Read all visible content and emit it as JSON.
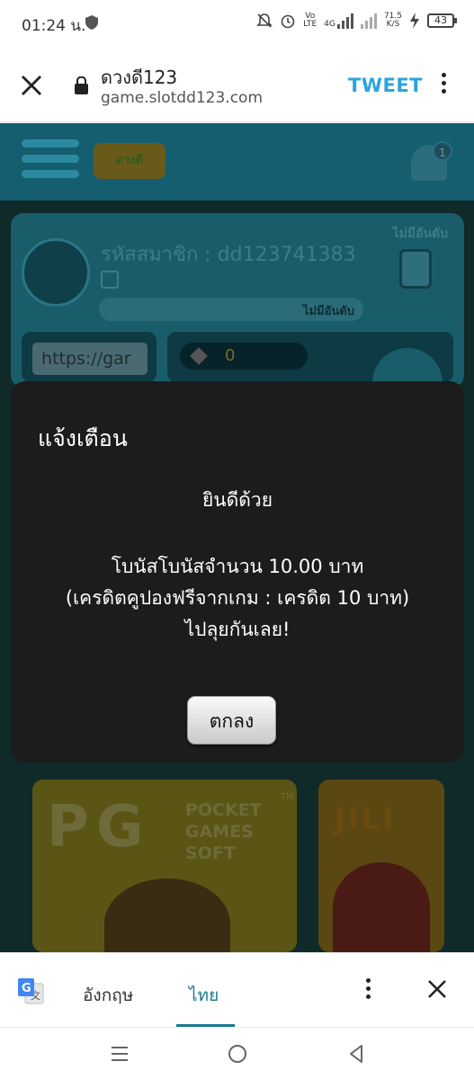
{
  "status_bar": {
    "time": "01:24 น.",
    "network_label_top": "Vo",
    "network_label_bottom": "LTE",
    "net_gen": "4G",
    "speed_value": "71.5",
    "speed_unit": "K/S",
    "battery": "43"
  },
  "browser": {
    "page_title": "ดวงดี123",
    "url": "game.slotdd123.com",
    "tweet_label": "TWEET"
  },
  "game": {
    "logo_text": "ดวงดี",
    "notification_count": "1",
    "member_code": "รหัสสมาชิก : dd123741383",
    "rank_label_top": "ไม่มีอันดับ",
    "rank_label_bar": "ไม่มีอันดับ",
    "referral_url": "https://gar",
    "credit": "0",
    "pg_big": "PG",
    "pg_words": [
      "POCKET",
      "GAMES",
      "SOFT"
    ],
    "pg_tm": "TM",
    "jili_text": "JILI"
  },
  "dialog": {
    "title": "แจ้งเตือน",
    "greeting": "ยินดีด้วย",
    "bonus_line": "โบนัสโบนัสจำนวน 10.00 บาท",
    "detail_line": "(เครดิตคูปองฟรีจากเกม : เครดิต 10 บาท)",
    "closing_line": "ไปลุยกันเลย!",
    "ok_label": "ตกลง"
  },
  "translate_bar": {
    "source_lang": "อังกฤษ",
    "target_lang": "ไทย"
  },
  "colors": {
    "accent": "#2ea3dc",
    "translate_accent": "#1b7a8f",
    "dialog_bg": "#1c1c1c"
  }
}
